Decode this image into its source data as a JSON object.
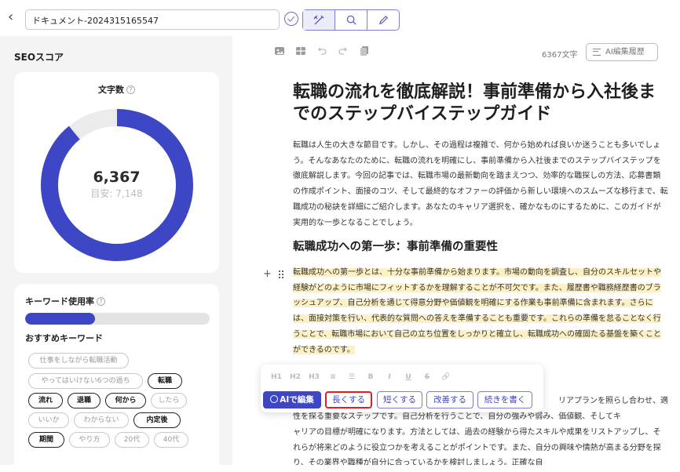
{
  "header": {
    "doc_title": "ドキュメント-2024315165547"
  },
  "seo": {
    "title": "SEOスコア",
    "word_count_label": "文字数",
    "help_glyph": "?",
    "word_count_value": "6,367",
    "word_count_target": "目安: 7,148",
    "word_count_ratio": 0.891,
    "keyword_usage_label": "キーワード使用率",
    "keyword_usage_ratio": 0.38,
    "recommended_label": "おすすめキーワード",
    "chips": [
      {
        "label": "仕事をしながら転職活動",
        "used": false
      },
      {
        "label": "やってはいけない6つの過ち",
        "used": false
      },
      {
        "label": "転職",
        "used": true
      },
      {
        "label": "流れ",
        "used": true
      },
      {
        "label": "退職",
        "used": true
      },
      {
        "label": "何から",
        "used": true
      },
      {
        "label": "したら",
        "used": false
      },
      {
        "label": "いいか",
        "used": false
      },
      {
        "label": "わからない",
        "used": false
      },
      {
        "label": "内定後",
        "used": true
      },
      {
        "label": "期間",
        "used": true
      },
      {
        "label": "やり方",
        "used": false
      },
      {
        "label": "20代",
        "used": false
      },
      {
        "label": "40代",
        "used": false
      }
    ]
  },
  "editor": {
    "char_count": "6367文字",
    "history_label": "AI編集履歴",
    "title": "転職の流れを徹底解説！事前準備から入社後までのステップバイステップガイド",
    "intro": "転職は人生の大きな節目です。しかし、その過程は複雑で、何から始めれば良いか迷うことも多いでしょう。そんなあなたのために、転職の流れを明確にし、事前準備から入社後までのステップバイステップを徹底解説します。今回の記事では、転職市場の最新動向を踏まえつつ、効率的な職探しの方法、応募書類の作成ポイント、面接のコツ、そして最終的なオファーの評価から新しい環境へのスムーズな移行まで、転職成功の秘訣を詳細にご紹介します。あなたのキャリア選択を、確かなものにするために、このガイドが実用的な一歩となることでしょう。",
    "section_heading": "転職成功への第一歩：事前準備の重要性",
    "highlighted": "転職成功への第一歩とは、十分な事前準備から始まります。市場の動向を調査し、自分のスキルセットや経験がどのように市場にフィットするかを理解することが不可欠です。また、履歴書や職務経歴書のブラッシュアップ、自己分析を通じて得意分野や価値観を明確にする作業も事前準備に含まれます。さらには、面接対策を行い、代表的な質問への答えを準備することも重要です。これらの準備を怠ることなく行うことで、転職市場において自己の立ち位置をしっかりと確立し、転職成功への確固たる基盤を築くことができるのです。",
    "tail_line1": "リアプランを照らし合わせ、適",
    "tail_line2": "性を探る重要なステップです。自己分析を行うことで、自分の強みや弱み、価値観、そしてキ",
    "tail_rest": "ャリアの目標が明確になります。方法としては、過去の経験から得たスキルや成果をリストアップし、それらが将来どのように役立つかを考えることがポイントです。また、自分の興味や情熱が高まる分野を探り、その業界や職種が自分に合っているかを検討しましょう。正確な自"
  },
  "format_bar": {
    "icons": [
      "H1",
      "H2",
      "H3",
      "≡",
      "☰",
      "B",
      "I",
      "U",
      "S",
      "🔗"
    ],
    "ai_edit": "AIで編集",
    "actions": [
      "長くする",
      "短くする",
      "改善する",
      "続きを書く"
    ],
    "selected_action": 0
  },
  "colors": {
    "accent": "#3d46c4",
    "highlight": "#fdf0c4",
    "selected_outline": "#e02020"
  }
}
